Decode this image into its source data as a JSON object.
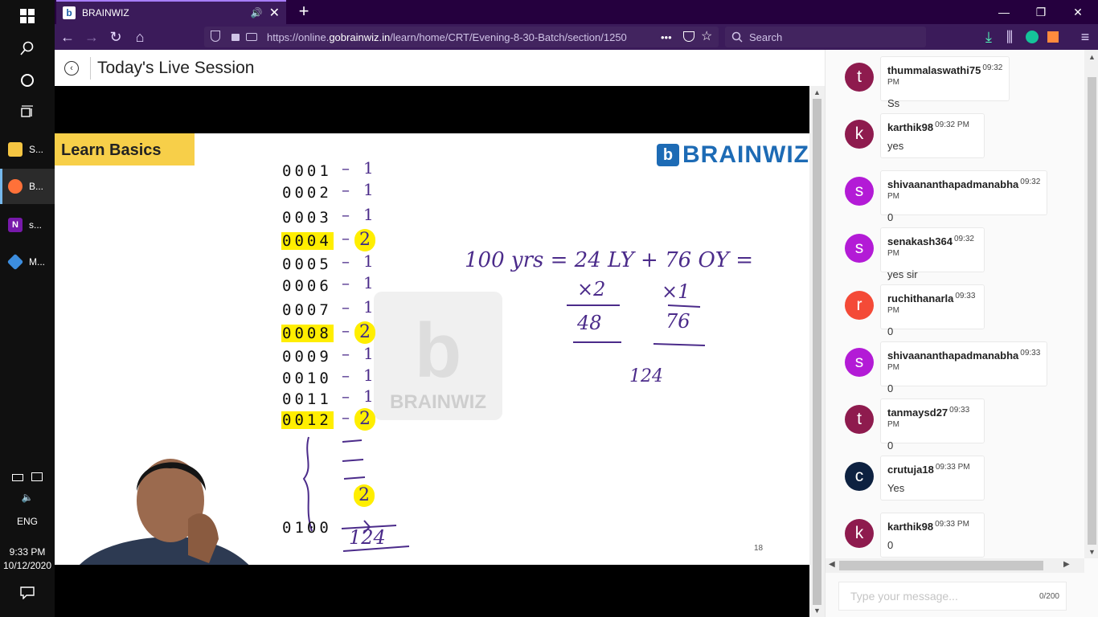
{
  "taskbar": {
    "apps": [
      {
        "label": "S...",
        "icon": "folder-icon",
        "color": "#f5c542"
      },
      {
        "label": "B...",
        "icon": "firefox-icon",
        "color": "#ff7139"
      },
      {
        "label": "s...",
        "icon": "onenote-icon",
        "color": "#7719aa"
      },
      {
        "label": "M...",
        "icon": "git-icon",
        "color": "#3c8dde"
      }
    ],
    "lang": "ENG",
    "time": "9:33 PM",
    "date": "10/12/2020"
  },
  "browser": {
    "tab_title": "BRAINWIZ",
    "tab_favicon": "b",
    "url_prefix": "https://online.",
    "url_domain": "gobrainwiz.in",
    "url_path": "/learn/home/CRT/Evening-8-30-Batch/section/1250",
    "url_more": "•••",
    "search_placeholder": "Search"
  },
  "page": {
    "title": "Today's Live Session"
  },
  "slide": {
    "tag": "Learn Basics",
    "logo_text": "BRAINWIZ",
    "logo_mark": "b",
    "watermark_text": "BRAINWIZ",
    "rows": [
      {
        "num": "0001",
        "mark": "1"
      },
      {
        "num": "0002",
        "mark": "1"
      },
      {
        "num": "0003",
        "mark": "1"
      },
      {
        "num": "0004",
        "mark": "2"
      },
      {
        "num": "0005",
        "mark": "1"
      },
      {
        "num": "0006",
        "mark": "1"
      },
      {
        "num": "0007",
        "mark": "1"
      },
      {
        "num": "0008",
        "mark": "2"
      },
      {
        "num": "0009",
        "mark": "1"
      },
      {
        "num": "0010",
        "mark": "1"
      },
      {
        "num": "0011",
        "mark": "1"
      },
      {
        "num": "0012",
        "mark": "2"
      }
    ],
    "last_num": "0100",
    "total": "124",
    "equation": "100 yrs = 24 LY + 76 OY =",
    "mult_left": "×2",
    "result_left": "48",
    "mult_right": "×1",
    "result_right": "76",
    "sum": "124",
    "page_number": "18"
  },
  "chat": {
    "messages": [
      {
        "initial": "t",
        "color": "#8e1b4e",
        "user": "thummalaswathi75",
        "time": "09:32 PM",
        "text": "Ss"
      },
      {
        "initial": "k",
        "color": "#8e1b4e",
        "user": "karthik98",
        "time": "09:32 PM",
        "text": "yes"
      },
      {
        "initial": "s",
        "color": "#b31bd6",
        "user": "shivaananthapadmanabha",
        "time": "09:32 PM",
        "text": "0"
      },
      {
        "initial": "s",
        "color": "#b31bd6",
        "user": "senakash364",
        "time": "09:32 PM",
        "text": "yes sir"
      },
      {
        "initial": "r",
        "color": "#f44a37",
        "user": "ruchithanarla",
        "time": "09:33 PM",
        "text": "0"
      },
      {
        "initial": "s",
        "color": "#b31bd6",
        "user": "shivaananthapadmanabha",
        "time": "09:33 PM",
        "text": "0"
      },
      {
        "initial": "t",
        "color": "#8e1b4e",
        "user": "tanmaysd27",
        "time": "09:33 PM",
        "text": "0"
      },
      {
        "initial": "c",
        "color": "#0d2140",
        "user": "crutuja18",
        "time": "09:33 PM",
        "text": "Yes"
      },
      {
        "initial": "k",
        "color": "#8e1b4e",
        "user": "karthik98",
        "time": "09:33 PM",
        "text": "0"
      }
    ],
    "input_placeholder": "Type your message...",
    "char_count": "0/200"
  }
}
